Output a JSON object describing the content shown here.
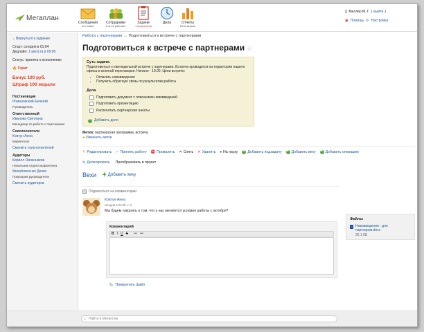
{
  "app": {
    "logo_text": "Мегаплан"
  },
  "nav": [
    {
      "label": "Сообщения",
      "sub": "нет новых",
      "icon": "envelope-icon"
    },
    {
      "label": "Сотрудники",
      "sub": "1 из 24 работает",
      "icon": "people-icon"
    },
    {
      "label": "Задачи",
      "sub": "1 просрочена",
      "icon": "tasks-icon"
    },
    {
      "label": "Дела",
      "sub": "",
      "icon": "clock-icon"
    },
    {
      "label": "Отчеты",
      "sub": "Бета-версия",
      "icon": "chart-icon"
    }
  ],
  "user": {
    "name": "Миллер М. Г.",
    "logout": "выйти",
    "help": "Помощь",
    "settings": "Настройка"
  },
  "sidebar": {
    "back": "Вернуться к задачам",
    "start": "Старт: сегодня в 01:04",
    "deadline_label": "Дедлайн:",
    "deadline_value": "1 августа в 09:00",
    "status": "Статус: принята к исполнению",
    "hot": "Горит",
    "bonus": "Бонус 100 руб.",
    "penalty": "Штраф 100 морали",
    "owner_h": "Постановщик",
    "owner_name": "Романовский Евгений",
    "owner_role": "Руководитель",
    "resp_h": "Ответственный",
    "resp_name": "Иванова Светлана",
    "resp_role": "Менеджер по работе с партнерами",
    "coexec_h": "Соисполнители",
    "coexec_name": "Ковтун Анна",
    "coexec_role": "Маркетолог",
    "coexec_change": "Сменить соисполнителей",
    "aud_h": "Аудиторы",
    "aud1_name": "Кирилл Овчинников",
    "aud1_role": "Начальник отдела маркетинга",
    "aud2_name": "Михайличенко Денис",
    "aud2_role": "Помощник руководителя",
    "aud_change": "Сменить аудиторов"
  },
  "crumbs": {
    "link": "Работа с партнерами",
    "sep": "→",
    "current": "Подготовиться к встрече с партнерами"
  },
  "task": {
    "title": "Подготовиться к встрече с партнерами",
    "essence_h": "Суть задачи.",
    "essence_text": "Подготовиться к еженедельной встрече с партнерами. Встреча проводится на территории нашего офиса в зеленой переговорке. Начало - 10.00. Цели встречи:",
    "goals": [
      "Огласить нововведения",
      "Получить обратную связь по результатам работы"
    ],
    "todo_h": "Дела",
    "todos": [
      "Подготовить документ с описанием нововведений",
      "Подготовить презентацию",
      "Распечатать партнерские анкеты"
    ],
    "add_todo": "Добавить дело",
    "tags_label": "Метки:",
    "tags": "партнерская программа, встреча",
    "edit_tags": "Изменить метки"
  },
  "actions": [
    "Редактировать",
    "Принять работу",
    "Провалить",
    "Снять",
    "Удалить",
    "На паузу",
    "Добавить подзадачу",
    "Добавить веху",
    "Добавить операцию"
  ],
  "actions2": [
    "Делегировать",
    "Преобразовать в проект"
  ],
  "milestones": {
    "title": "Вехи",
    "add": "Добавить веху"
  },
  "comments": {
    "subscribe": "Подписаться на комментарии",
    "author": "Ковтун Анна",
    "meta": "сегодня в 01:09",
    "text": "Мы будем говорить о том, что у нас меняются условия работы с октября?",
    "editor_label": "Комментарий",
    "toolbar": [
      "B",
      "I",
      "U",
      "S",
      "≔",
      "≔"
    ],
    "attach": "Прикрепить файл"
  },
  "files": {
    "title": "Файлы",
    "name": "Нововведения - для партнеров.docx",
    "size": "26.1 КБ"
  },
  "footer": {
    "search_placeholder": "Найти в Мегаплан"
  }
}
